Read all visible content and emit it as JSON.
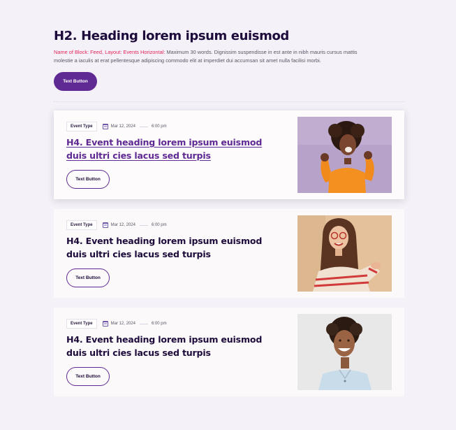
{
  "header": {
    "title": "H2. Heading lorem ipsum euismod",
    "highlight": "Name of Block: Feed, Layout: Events Horizontal:",
    "description": " Maximum 30 words. Dignissim suspendisse in est ante in nibh mauris cursus mattis molestie a iaculis at erat pellentesque adipiscing commodo elit at imperdiet dui accumsan sit amet nulla facilisi morbi.",
    "button_label": "Text Button"
  },
  "events": [
    {
      "type": "Event Type",
      "date": "Mar 12, 2024",
      "time": "6:00 pm",
      "title": "H4. Event heading lorem ipsum euismod duis ultri cies lacus sed turpis",
      "button_label": "Text Button",
      "image": "woman-orange-sweater-celebrating-photo"
    },
    {
      "type": "Event Type",
      "date": "Mar 12, 2024",
      "time": "6:00 pm",
      "title": "H4. Event heading lorem ipsum euismod duis ultri cies lacus sed turpis",
      "button_label": "Text Button",
      "image": "woman-glasses-pointing-photo"
    },
    {
      "type": "Event Type",
      "date": "Mar 12, 2024",
      "time": "6:00 pm",
      "title": "H4. Event heading lorem ipsum euismod duis ultri cies lacus sed turpis",
      "button_label": "Text Button",
      "image": "smiling-man-curly-hair-photo"
    }
  ],
  "icons": {
    "date": "calendar-icon"
  },
  "colors": {
    "accent": "#5f2a93",
    "highlight": "#e2245a",
    "heading": "#1d0b3b",
    "background": "#f4f2f8"
  }
}
